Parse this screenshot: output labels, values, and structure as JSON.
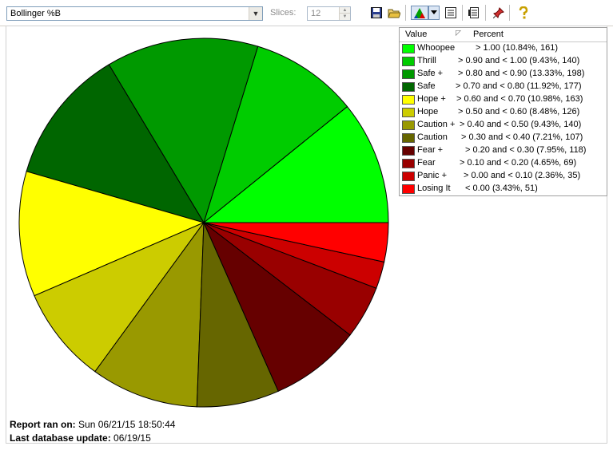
{
  "toolbar": {
    "indicator_select": "Bollinger %B",
    "slices_label": "Slices:",
    "slices_value": "12"
  },
  "icons": [
    "save-icon",
    "open-folder-icon",
    "pie-chart-icon",
    "dropdown-arrow-icon",
    "list-icon",
    "report-icon",
    "pin-icon",
    "help-icon"
  ],
  "legend": {
    "col_value": "Value",
    "col_percent": "Percent"
  },
  "chart_data": {
    "type": "pie",
    "title": "",
    "slices": [
      {
        "label": "Whoopee",
        "range": "> 1.00",
        "percent": 10.84,
        "count": 161,
        "text": "> 1.00 (10.84%, 161)",
        "color": "#00ff00"
      },
      {
        "label": "Thrill",
        "range": "> 0.90 and < 1.00",
        "percent": 9.43,
        "count": 140,
        "text": "> 0.90 and < 1.00 (9.43%, 140)",
        "color": "#00cc00"
      },
      {
        "label": "Safe +",
        "range": "> 0.80 and < 0.90",
        "percent": 13.33,
        "count": 198,
        "text": "> 0.80 and < 0.90 (13.33%, 198)",
        "color": "#009900"
      },
      {
        "label": "Safe",
        "range": "> 0.70 and < 0.80",
        "percent": 11.92,
        "count": 177,
        "text": "> 0.70 and < 0.80 (11.92%, 177)",
        "color": "#006600"
      },
      {
        "label": "Hope +",
        "range": "> 0.60 and < 0.70",
        "percent": 10.98,
        "count": 163,
        "text": "> 0.60 and < 0.70 (10.98%, 163)",
        "color": "#ffff00"
      },
      {
        "label": "Hope",
        "range": "> 0.50 and < 0.60",
        "percent": 8.48,
        "count": 126,
        "text": "> 0.50 and < 0.60 (8.48%, 126)",
        "color": "#cccc00"
      },
      {
        "label": "Caution +",
        "range": "> 0.40 and < 0.50",
        "percent": 9.43,
        "count": 140,
        "text": "> 0.40 and < 0.50 (9.43%, 140)",
        "color": "#999900"
      },
      {
        "label": "Caution",
        "range": "> 0.30 and < 0.40",
        "percent": 7.21,
        "count": 107,
        "text": "> 0.30 and < 0.40 (7.21%, 107)",
        "color": "#666600"
      },
      {
        "label": "Fear +",
        "range": "> 0.20 and < 0.30",
        "percent": 7.95,
        "count": 118,
        "text": "> 0.20 and < 0.30 (7.95%, 118)",
        "color": "#660000"
      },
      {
        "label": "Fear",
        "range": "> 0.10 and < 0.20",
        "percent": 4.65,
        "count": 69,
        "text": "> 0.10 and < 0.20 (4.65%, 69)",
        "color": "#990000"
      },
      {
        "label": "Panic +",
        "range": "> 0.00 and < 0.10",
        "percent": 2.36,
        "count": 35,
        "text": "> 0.00 and < 0.10 (2.36%, 35)",
        "color": "#cc0000"
      },
      {
        "label": "Losing It",
        "range": "< 0.00",
        "percent": 3.43,
        "count": 51,
        "text": "< 0.00 (3.43%, 51)",
        "color": "#ff0000"
      }
    ],
    "legend_placement": "top-right"
  },
  "footer": {
    "report_label": "Report ran on:",
    "report_value": "Sun 06/21/15 18:50:44",
    "db_label": "Last database update:",
    "db_value": "06/19/15"
  }
}
